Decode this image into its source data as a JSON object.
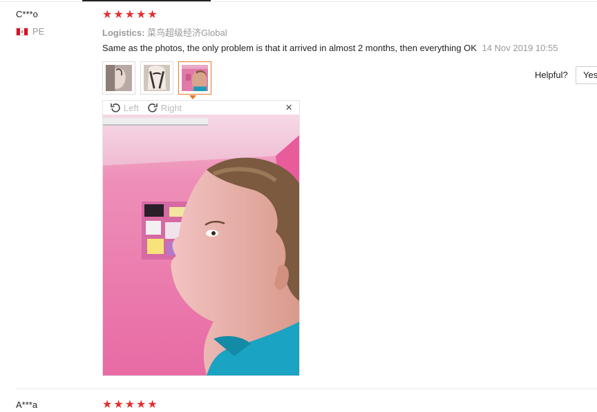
{
  "reviews": [
    {
      "user": "C***o",
      "country": "PE",
      "rating": 5,
      "logistics_label": "Logistics:",
      "logistics_value": "菜鸟超级经济Global",
      "text": "Same as the photos, the only problem is that it arrived in almost 2 months, then everything OK",
      "date": "14 Nov 2019 10:55",
      "photo_count": 3,
      "selected_photo": 3
    },
    {
      "user": "A***a",
      "rating": 5
    }
  ],
  "helpful": {
    "label": "Helpful?",
    "yes_label": "Yes"
  },
  "viewer": {
    "rotate_left_label": "Left",
    "rotate_right_label": "Right",
    "close_glyph": "×"
  },
  "icons": {
    "star": "star-icon",
    "rotate_left": "rotate-left-icon",
    "rotate_right": "rotate-right-icon",
    "close": "close-icon",
    "flag": "peru-flag-icon"
  },
  "colors": {
    "star": "#e62e2e",
    "active_border": "#e87722",
    "muted_text": "#999999"
  }
}
